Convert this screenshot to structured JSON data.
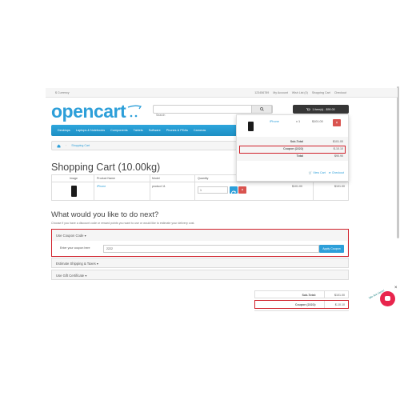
{
  "topbar": {
    "currency": "$ Currency",
    "phone": "123456789",
    "account": "My Account",
    "wishlist": "Wish List (0)",
    "cart": "Shopping Cart",
    "checkout": "Checkout"
  },
  "header": {
    "logo": "opencart",
    "search_placeholder": "Search",
    "cart_button": "1 item(s) - $90.00"
  },
  "nav": [
    "Desktops",
    "Laptops & Notebooks",
    "Components",
    "Tablets",
    "Software",
    "Phones & PDAs",
    "Cameras"
  ],
  "breadcrumb": {
    "current": "Shopping Cart"
  },
  "dropdown": {
    "item_name": "iPhone",
    "item_qty": "x 1",
    "item_price": "$101.00",
    "subtotal_label": "Sub-Total",
    "subtotal_value": "$101.00",
    "coupon_label": "Coupon (2222)",
    "coupon_value": "$-10.10",
    "total_label": "Total",
    "total_value": "$90.90",
    "view_cart": "View Cart",
    "checkout": "Checkout"
  },
  "page": {
    "title": "Shopping Cart",
    "weight": "(10.00kg)"
  },
  "table": {
    "headers": [
      "Image",
      "Product Name",
      "Model",
      "Quantity"
    ],
    "row": {
      "name": "iPhone",
      "model": "product 11",
      "qty": "1",
      "unit_price": "$101.00",
      "total": "$101.00"
    }
  },
  "next": {
    "heading": "What would you like to do next?",
    "desc": "Choose if you have a discount code or reward points you want to use or would like to estimate your delivery cost."
  },
  "coupon": {
    "title": "Use Coupon Code",
    "label": "Enter your coupon here",
    "value": "2222",
    "apply": "Apply Coupon"
  },
  "shipping": {
    "title": "Estimate Shipping & Taxes"
  },
  "gift": {
    "title": "Use Gift Certificate"
  },
  "totals": {
    "subtotal_label": "Sub-Total:",
    "subtotal_value": "$101.00",
    "coupon_label": "Coupon (2222):",
    "coupon_value": "$-10.10"
  },
  "chat": {
    "label": "We Are Here!"
  }
}
